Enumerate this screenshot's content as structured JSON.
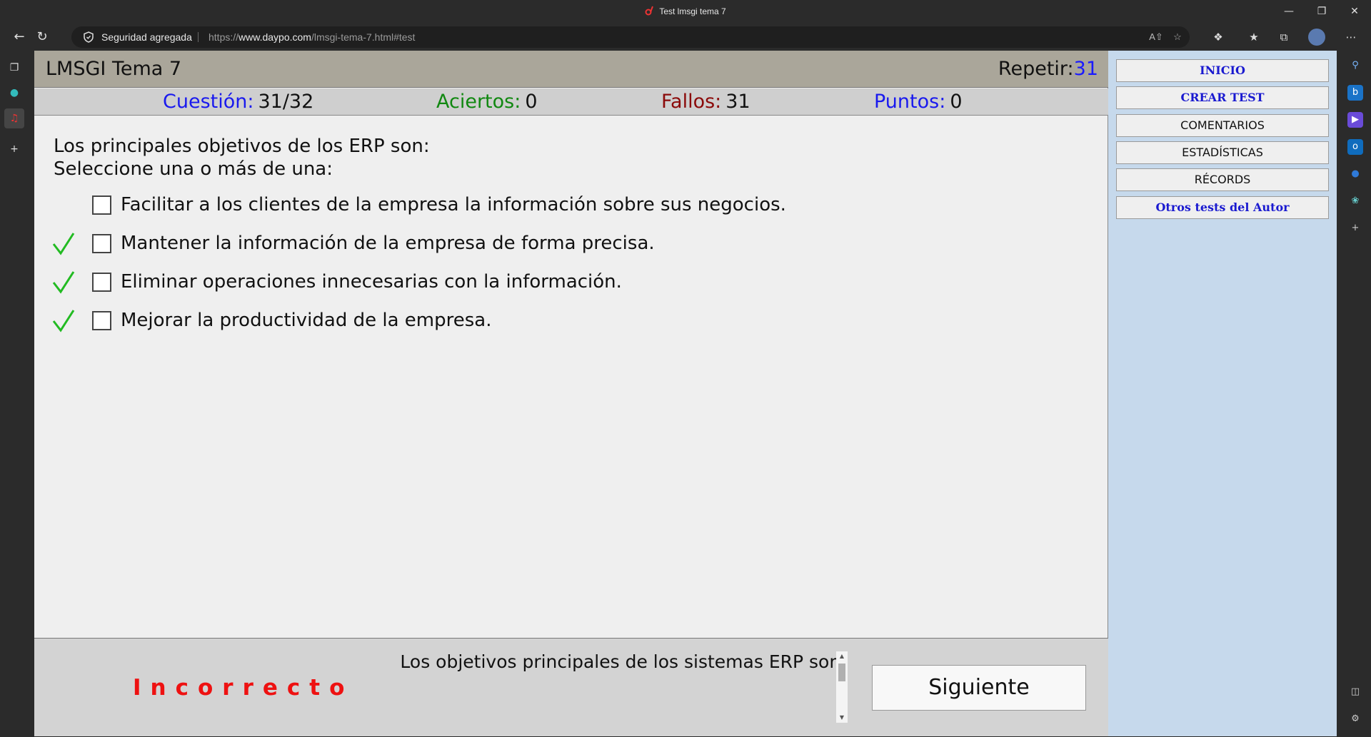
{
  "browser": {
    "window_title": "Test lmsgi tema 7",
    "security_label": "Seguridad agregada",
    "url_scheme": "https://",
    "url_host": "www.daypo.com",
    "url_path": "/lmsgi-tema-7.html#test"
  },
  "header": {
    "title": "LMSGI Tema 7",
    "repeat_label": "Repetir:",
    "repeat_value": "31"
  },
  "stats": {
    "question_label": "Cuestión:",
    "question_value": "31/32",
    "correct_label": "Aciertos:",
    "correct_value": "0",
    "wrong_label": "Fallos:",
    "wrong_value": "31",
    "points_label": "Puntos:",
    "points_value": "0"
  },
  "question": {
    "line1": "Los principales objetivos de los ERP son:",
    "line2": "Seleccione una o más de una:",
    "options": [
      {
        "text": "Facilitar a los clientes de la empresa la información sobre sus negocios.",
        "correct": false,
        "checked": false
      },
      {
        "text": "Mantener la información de la empresa de forma precisa.",
        "correct": true,
        "checked": false
      },
      {
        "text": "Eliminar operaciones innecesarias con la información.",
        "correct": true,
        "checked": false
      },
      {
        "text": "Mejorar la productividad de la empresa.",
        "correct": true,
        "checked": false
      }
    ]
  },
  "footer": {
    "result": "Incorrecto",
    "explanation": "Los objetivos principales de los sistemas ERP son:",
    "next_label": "Siguiente"
  },
  "sidebar": {
    "buttons": [
      {
        "label": "INICIO",
        "bold": true
      },
      {
        "label": "CREAR TEST",
        "bold": true
      },
      {
        "label": "COMENTARIOS",
        "bold": false
      },
      {
        "label": "ESTADÍSTICAS",
        "bold": false
      },
      {
        "label": "RÉCORDS",
        "bold": false
      },
      {
        "label": "Otros tests del Autor",
        "bold": true
      }
    ]
  },
  "colors": {
    "result_red": "#ee1111",
    "check_green": "#22bb22",
    "stat_blue": "#1a1aee",
    "stat_green": "#118811",
    "stat_red": "#8b0a0a"
  }
}
